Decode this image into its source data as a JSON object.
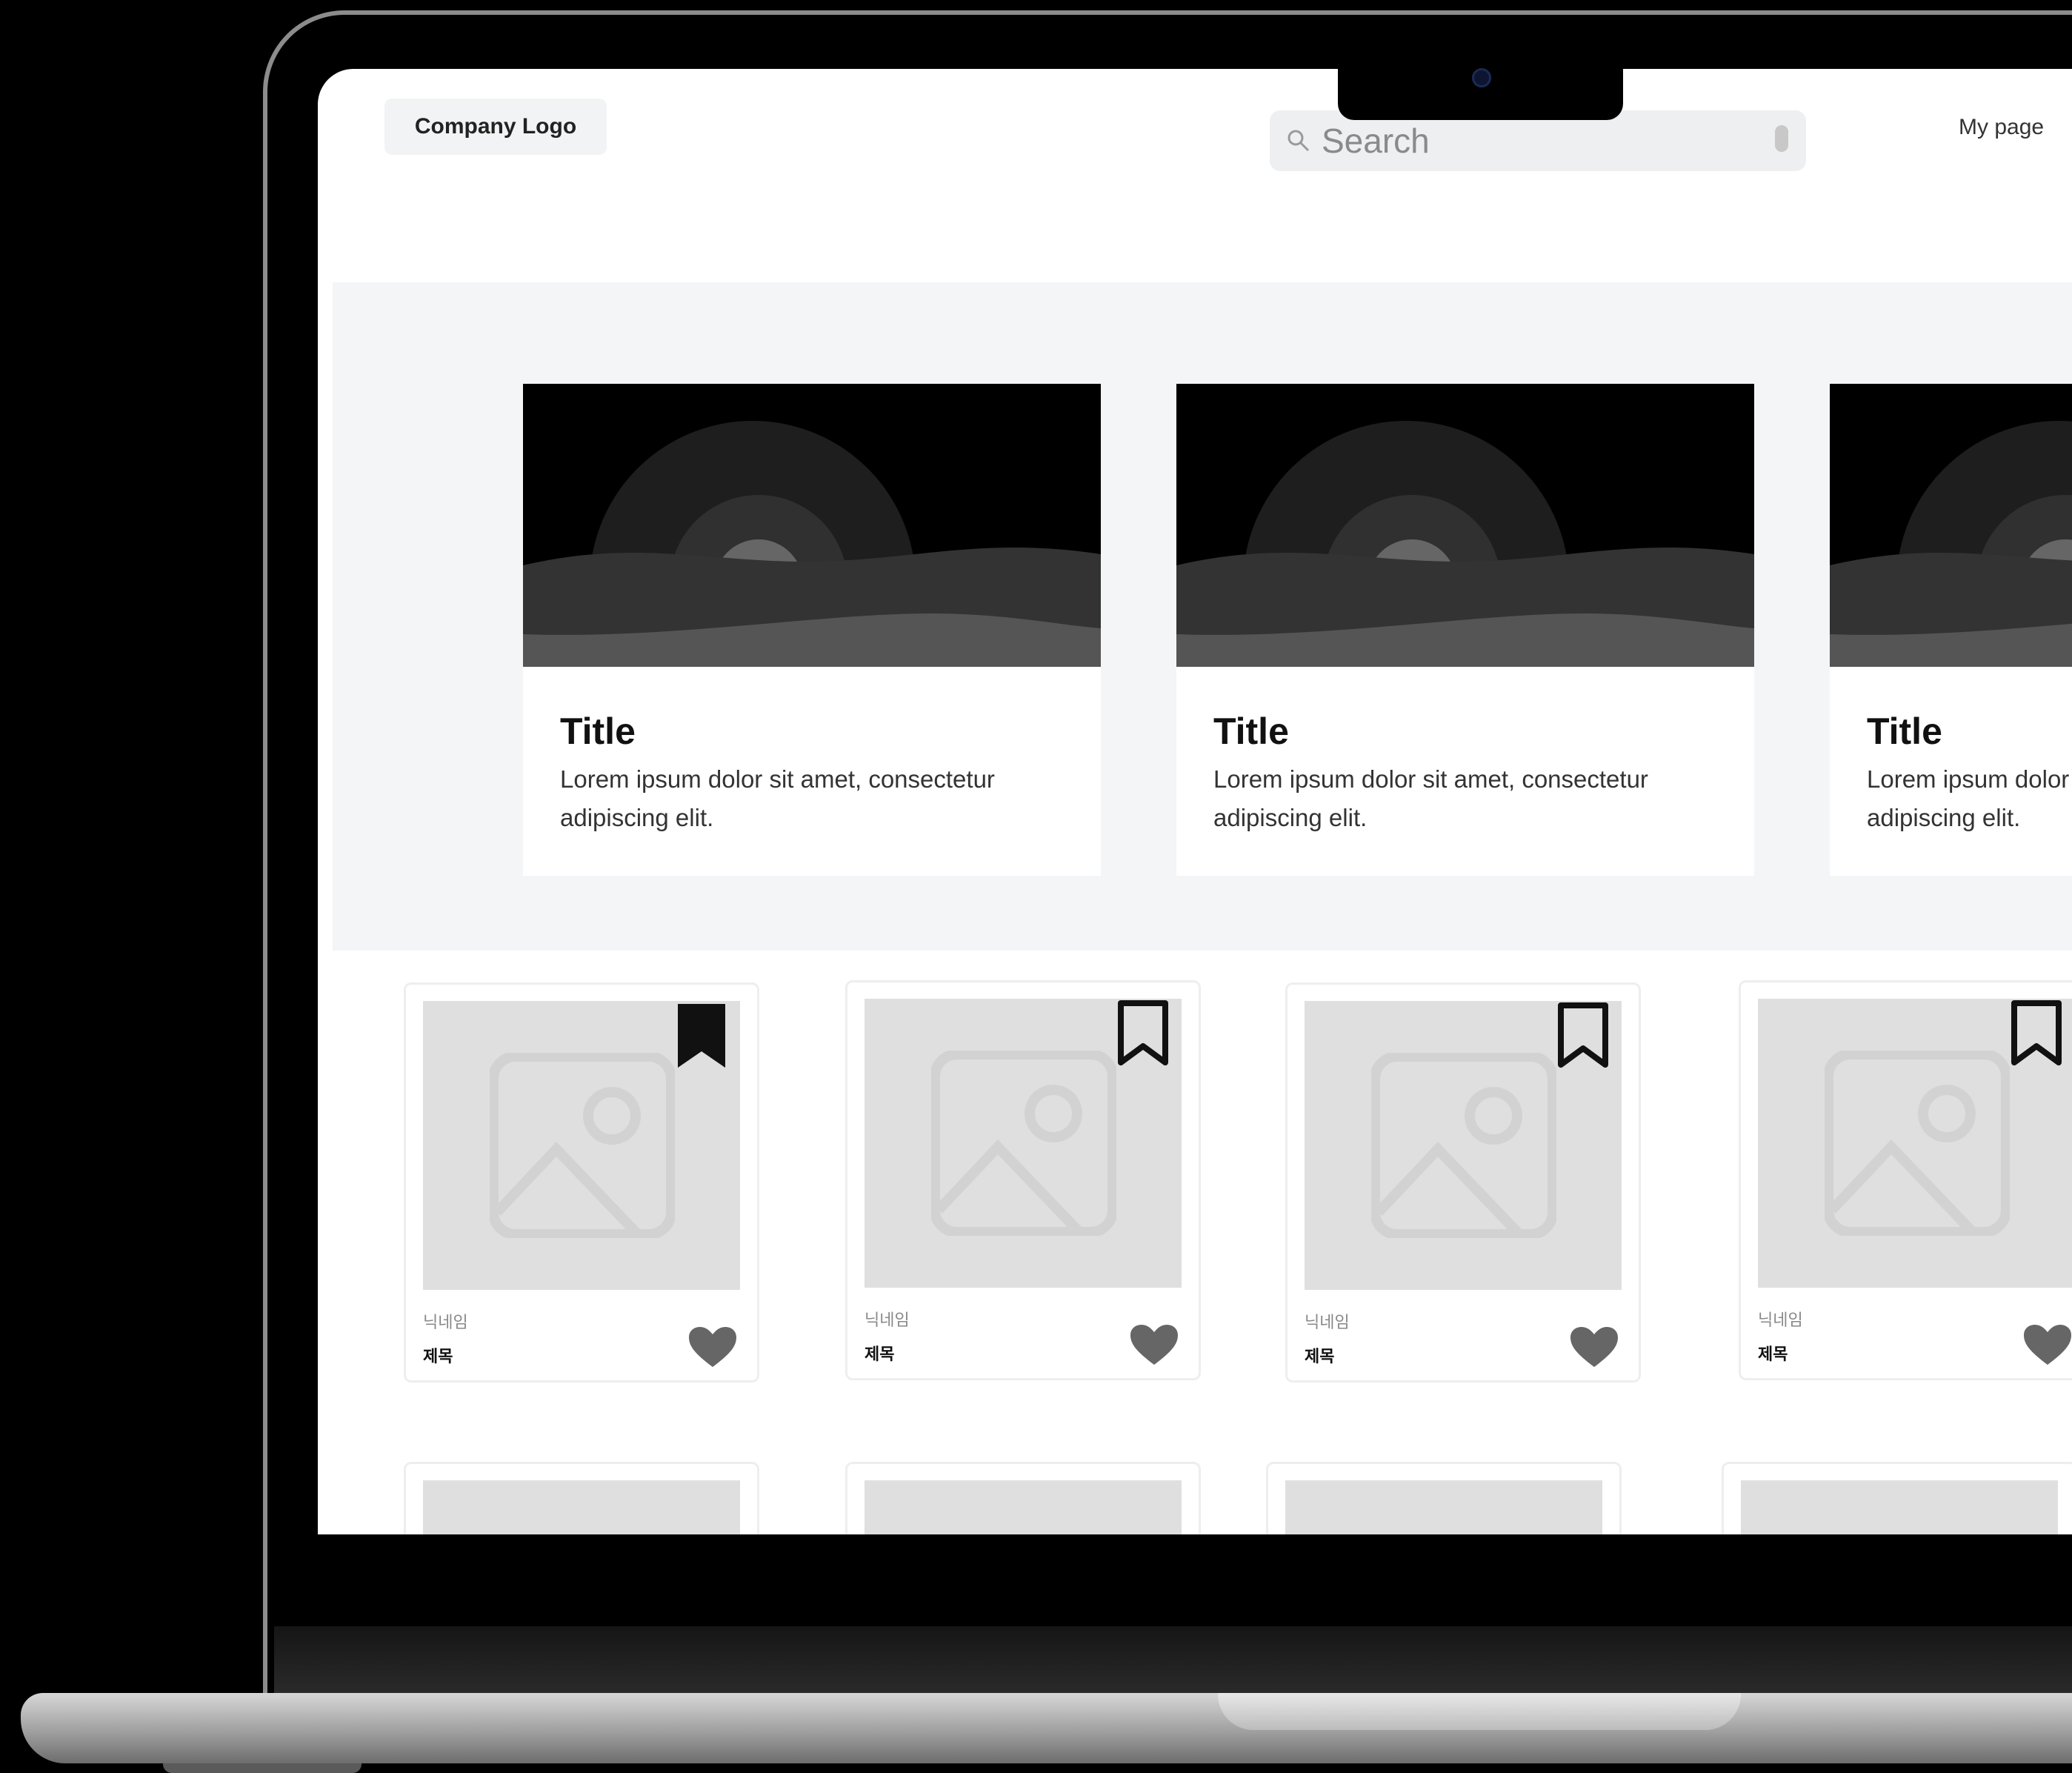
{
  "header": {
    "logo": "Company Logo",
    "search_placeholder": "Search",
    "my_page": "My page"
  },
  "banner_cards": [
    {
      "title": "Title",
      "description": "Lorem ipsum dolor sit amet, consectetur adipiscing elit."
    },
    {
      "title": "Title",
      "description": "Lorem ipsum dolor sit amet, consectetur adipiscing elit."
    },
    {
      "title": "Title",
      "description": "Lorem ipsum dolor sit amet, consectetur adipiscing elit."
    }
  ],
  "product_cards": [
    {
      "nickname": "닉네임",
      "title": "제목",
      "bookmarked": true
    },
    {
      "nickname": "닉네임",
      "title": "제목",
      "bookmarked": false
    },
    {
      "nickname": "닉네임",
      "title": "제목",
      "bookmarked": false
    },
    {
      "nickname": "닉네임",
      "title": "제목",
      "bookmarked": false
    }
  ],
  "colors": {
    "screen_bg": "#ffffff",
    "banner_bg": "#f4f5f7",
    "placeholder_gray": "#dfdfdf",
    "heart": "#666666",
    "bookmark": "#111111"
  }
}
